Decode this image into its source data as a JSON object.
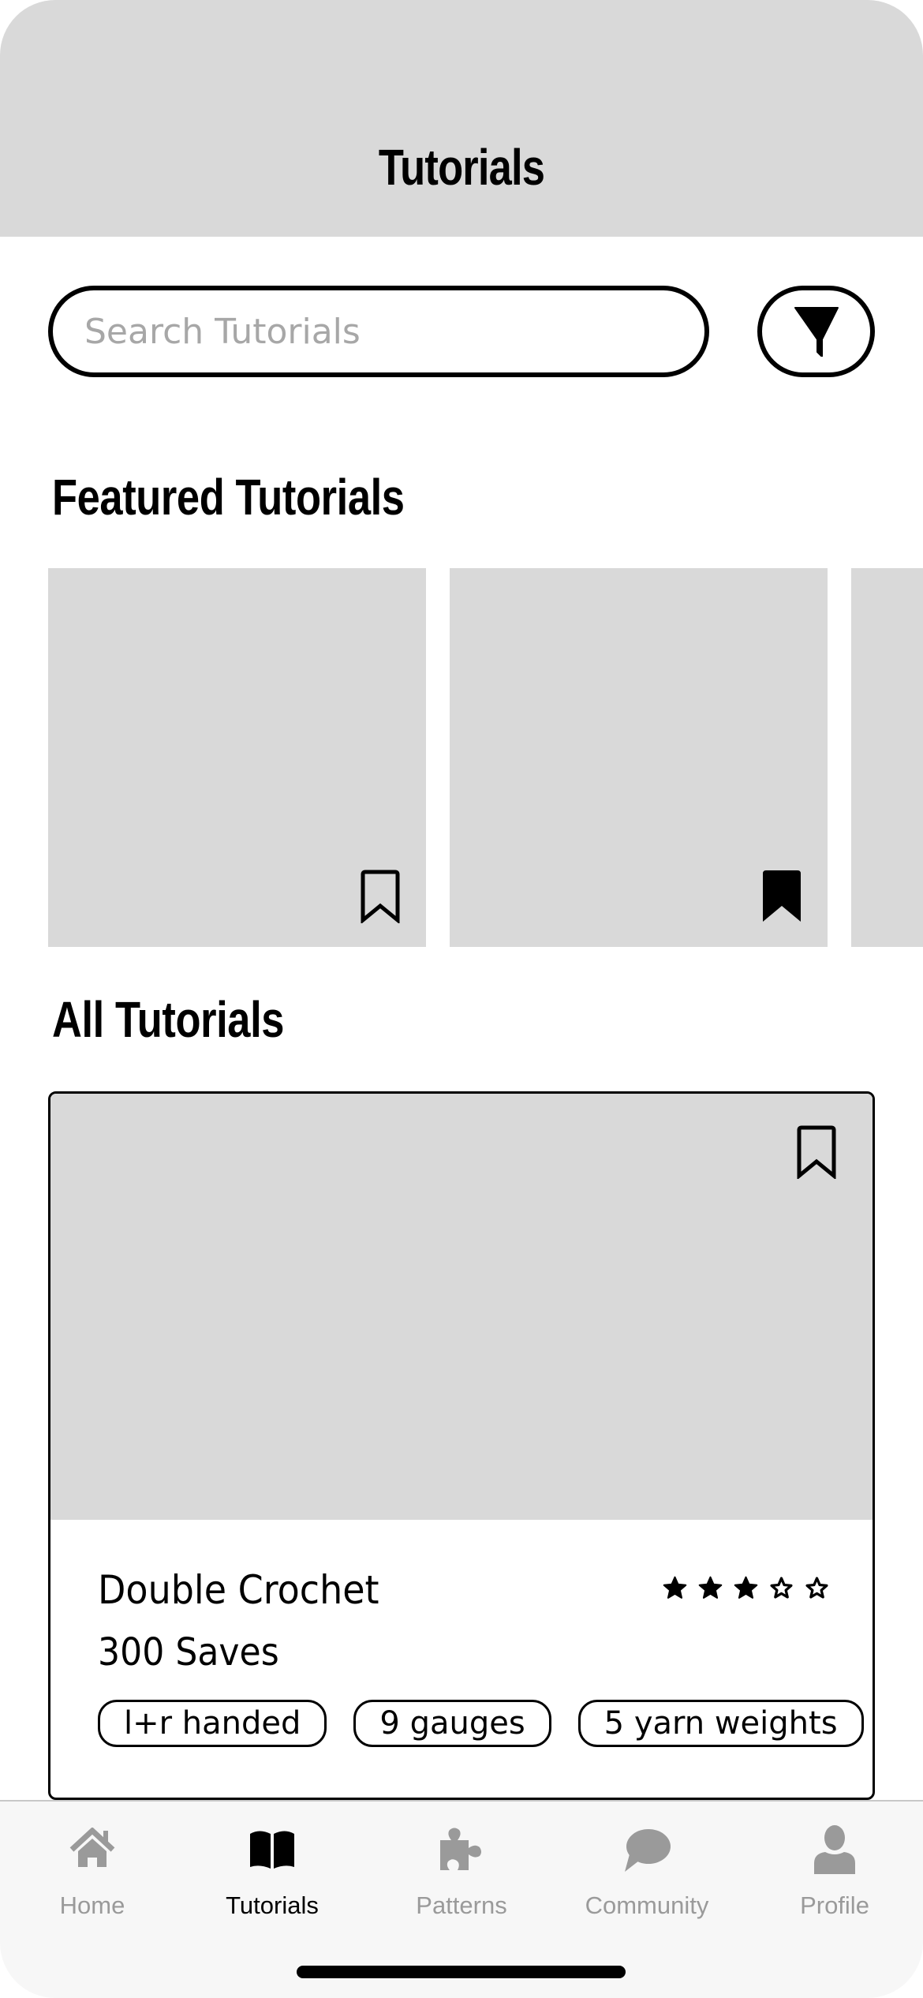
{
  "header": {
    "title": "Tutorials"
  },
  "search": {
    "placeholder": "Search Tutorials",
    "value": ""
  },
  "filter": {
    "icon": "filter-icon"
  },
  "featured": {
    "title": "Featured Tutorials",
    "cards": [
      {
        "bookmarked": false
      },
      {
        "bookmarked": true
      },
      {
        "bookmarked": false
      }
    ]
  },
  "all": {
    "title": "All Tutorials",
    "cards": [
      {
        "name": "Double Crochet",
        "saves": "300 Saves",
        "rating": 3,
        "rating_max": 5,
        "bookmarked": false,
        "tags": [
          "l+r handed",
          "9 gauges",
          "5 yarn weights"
        ]
      }
    ]
  },
  "tabbar": {
    "active": "Tutorials",
    "items": [
      {
        "label": "Home",
        "icon": "home-icon"
      },
      {
        "label": "Tutorials",
        "icon": "book-icon"
      },
      {
        "label": "Patterns",
        "icon": "puzzle-icon"
      },
      {
        "label": "Community",
        "icon": "chat-bubble-icon"
      },
      {
        "label": "Profile",
        "icon": "person-icon"
      }
    ]
  },
  "colors": {
    "placeholder_gray": "#d9d9d9",
    "inactive_tab": "#9a9a9a",
    "active_tab": "#000000",
    "tabbar_bg": "#f7f7f7"
  }
}
